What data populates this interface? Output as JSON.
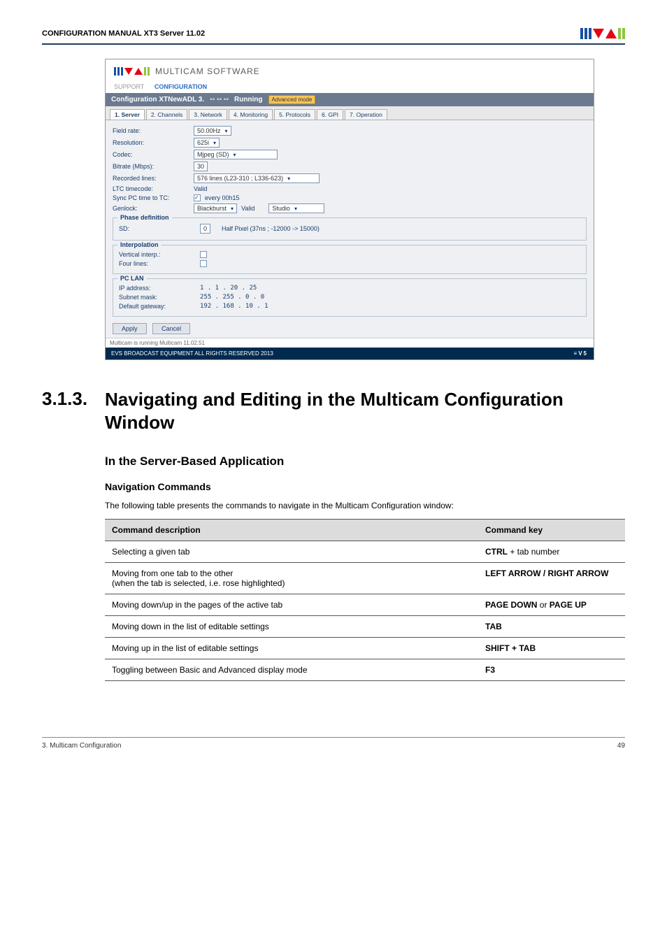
{
  "header": {
    "title": "CONFIGURATION MANUAL   XT3 Server 11.02"
  },
  "screenshot": {
    "brand_text": "MULTICAM SOFTWARE",
    "crumb_support": "SUPPORT",
    "crumb_config": "CONFIGURATION",
    "cfg_title": "Configuration XTNewADL 3.",
    "cfg_running": "Running",
    "adv_mode": "Advanced mode",
    "tabs": [
      "1. Server",
      "2. Channels",
      "3. Network",
      "4. Monitoring",
      "5. Protocols",
      "6. GPI",
      "7. Operation"
    ],
    "rows": {
      "field_rate_label": "Field rate:",
      "field_rate_value": "50.00Hz",
      "resolution_label": "Resolution:",
      "resolution_value": "625i",
      "codec_label": "Codec:",
      "codec_value": "Mjpeg (SD)",
      "bitrate_label": "Bitrate (Mbps):",
      "bitrate_value": "30",
      "reclines_label": "Recorded lines:",
      "reclines_value": "576 lines (L23-310 ; L336-623)",
      "ltc_label": "LTC timecode:",
      "ltc_value": "Valid",
      "syncpc_label": "Sync PC time to TC:",
      "syncpc_value": "every 00h15",
      "genlock_label": "Genlock:",
      "genlock_v1": "Blackburst",
      "genlock_v2": "Valid",
      "genlock_v3": "Studio"
    },
    "groups": {
      "phase": "Phase definition",
      "sd_label": "SD:",
      "sd_value": "0",
      "sd_hint": "Half Pixel (37ns ; -12000 -> 15000)",
      "interp": "Interpolation",
      "vint_label": "Vertical interp.:",
      "fourlines_label": "Four lines:",
      "pclan": "PC LAN",
      "ip_label": "IP address:",
      "ip_value": "1 .   1 .  20 .  25",
      "mask_label": "Subnet mask:",
      "mask_value": "255 . 255 .   0 .   0",
      "gw_label": "Default gateway:",
      "gw_value": "192 . 168 .  10 .   1"
    },
    "buttons": {
      "apply": "Apply",
      "cancel": "Cancel"
    },
    "status": "Multicam is running   Multicam 11.02.51",
    "footer": "EVS BROADCAST EQUIPMENT ALL RIGHTS RESERVED 2013",
    "footer_brand": "≡V5"
  },
  "section": {
    "num": "3.1.3.",
    "title": "Navigating and Editing in the Multicam Configuration Window"
  },
  "subhead": "In the Server-Based Application",
  "navcmds_head": "Navigation Commands",
  "navcmds_intro": "The following table presents the commands to navigate in the Multicam Configuration window:",
  "table": {
    "col1": "Command description",
    "col2": "Command key",
    "rows": [
      {
        "desc": "Selecting a given tab",
        "key": "CTRL + tab number",
        "key_plain": ""
      },
      {
        "desc": "Moving from one tab to the other\n(when the tab is selected, i.e. rose highlighted)",
        "key": "LEFT ARROW / RIGHT ARROW",
        "key_plain": ""
      },
      {
        "desc": "Moving down/up in the pages of the active tab",
        "key": "PAGE DOWN or PAGE UP",
        "key_plain": ""
      },
      {
        "desc": "Moving down in the list of editable settings",
        "key": "TAB",
        "key_plain": ""
      },
      {
        "desc": "Moving up in the list of editable settings",
        "key": "SHIFT + TAB",
        "key_plain": ""
      },
      {
        "desc": "Toggling between Basic and Advanced display mode",
        "key": "F3",
        "key_plain": ""
      }
    ],
    "row1_key_bold": "CTRL",
    "row1_key_rest": " + tab number",
    "row3_key_bold1": "PAGE DOWN",
    "row3_key_mid": " or ",
    "row3_key_bold2": "PAGE UP"
  },
  "footer": {
    "left": "3. Multicam Configuration",
    "right": "49"
  }
}
